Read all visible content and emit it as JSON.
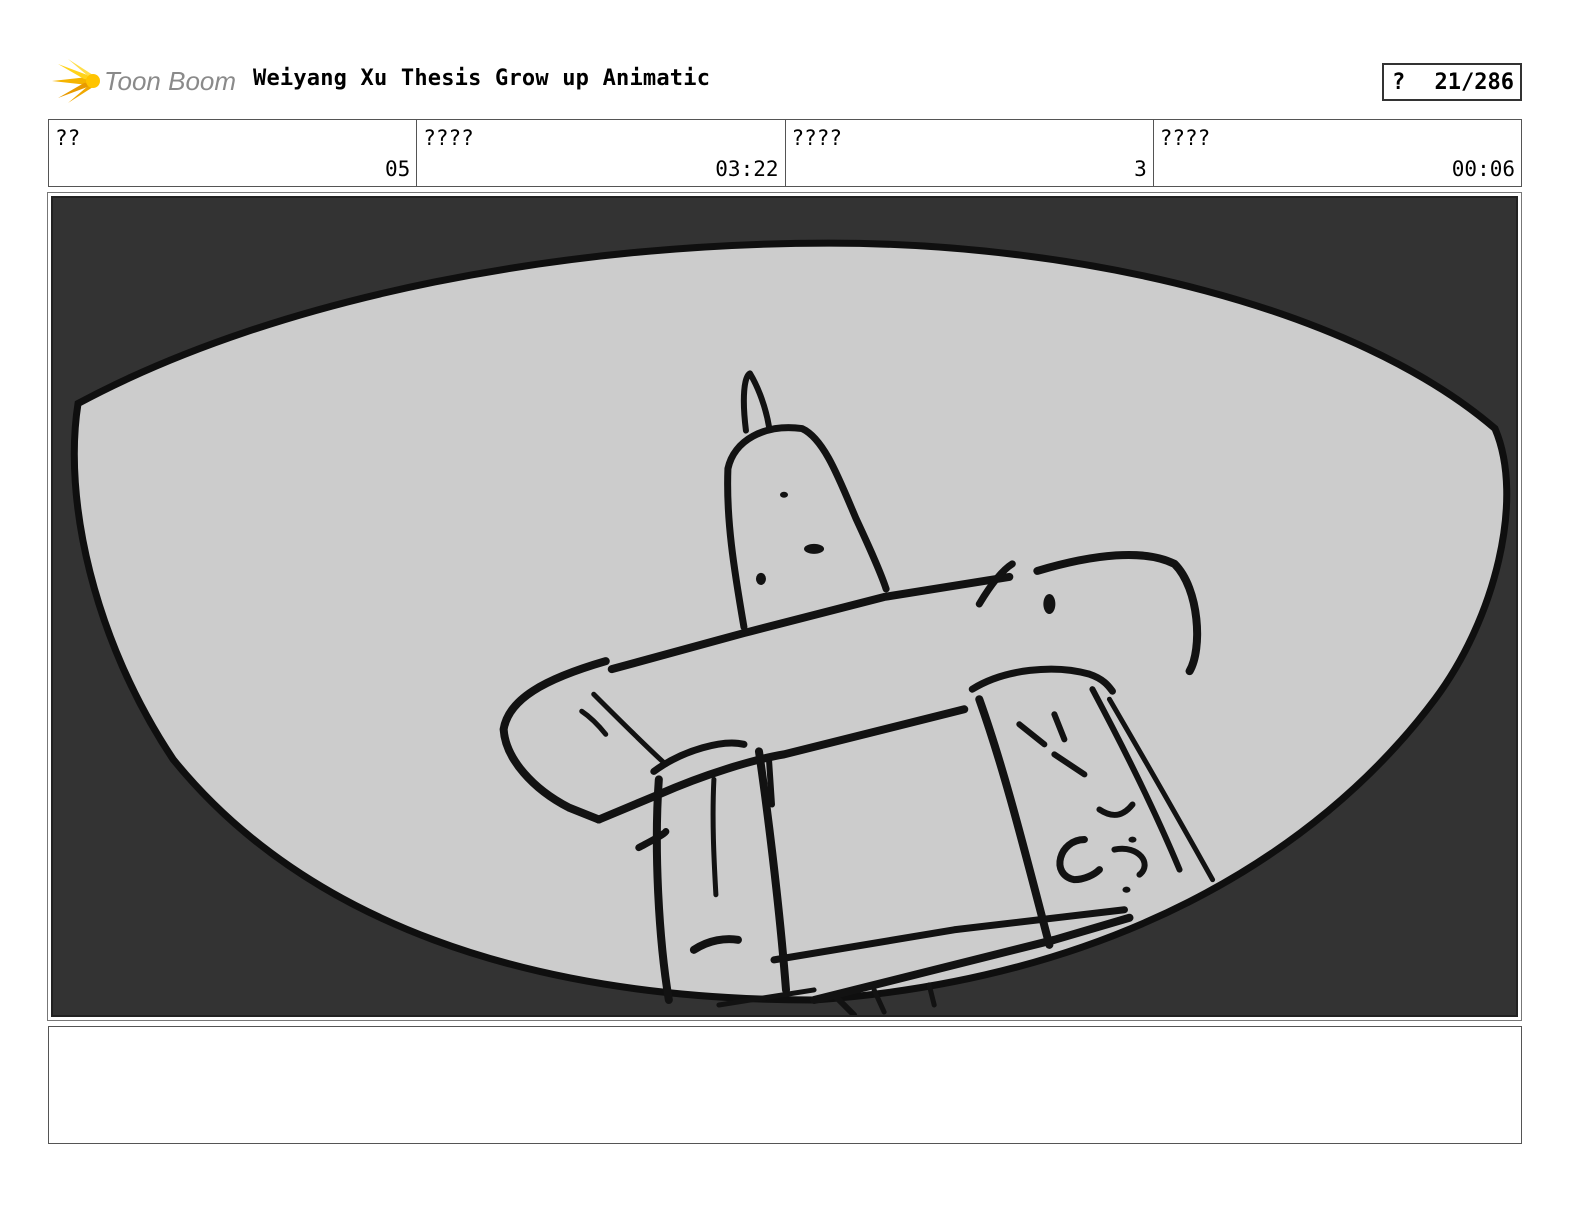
{
  "header": {
    "logo_text": "Toon Boom",
    "title": "Weiyang Xu Thesis Grow up Animatic",
    "page_marker": "?",
    "page_counter": "21/286"
  },
  "info": [
    {
      "label": "??",
      "value": "05"
    },
    {
      "label": "????",
      "value": "03:22"
    },
    {
      "label": "????",
      "value": "3"
    },
    {
      "label": "????",
      "value": "00:06"
    }
  ],
  "panel": {
    "background_color": "#333333",
    "fill_color": "#cccccc",
    "line_color": "#111111"
  },
  "notes": {
    "text": ""
  }
}
